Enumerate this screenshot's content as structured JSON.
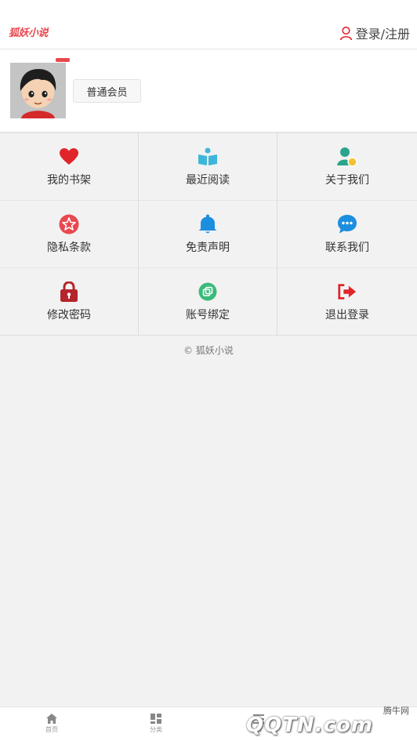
{
  "header": {
    "logo": "狐妖小说",
    "login_label": "登录/注册"
  },
  "profile": {
    "member_label": "普通会员"
  },
  "menu": [
    {
      "label": "我的书架",
      "icon": "heart-icon",
      "color": "#e0252a"
    },
    {
      "label": "最近阅读",
      "icon": "open-book-icon",
      "color": "#3fb6d8"
    },
    {
      "label": "关于我们",
      "icon": "user-coin-icon",
      "color": "#2aa58c"
    },
    {
      "label": "隐私条款",
      "icon": "star-badge-icon",
      "color": "#e8484f"
    },
    {
      "label": "免责声明",
      "icon": "bell-icon",
      "color": "#1c8ee0"
    },
    {
      "label": "联系我们",
      "icon": "chat-bubble-icon",
      "color": "#1c8ee0"
    },
    {
      "label": "修改密码",
      "icon": "lock-icon",
      "color": "#b3262b"
    },
    {
      "label": "账号绑定",
      "icon": "link-copy-icon",
      "color": "#3bba7a"
    },
    {
      "label": "退出登录",
      "icon": "logout-icon",
      "color": "#e0252a"
    }
  ],
  "footer": {
    "copyright": "© 狐妖小说"
  },
  "tabbar": [
    {
      "label": "首页",
      "icon": "home-icon"
    },
    {
      "label": "分类",
      "icon": "grid-icon"
    },
    {
      "label": "阅",
      "icon": "list-icon"
    }
  ],
  "watermark": {
    "site": "腾牛网",
    "logo": "QQTN.com"
  }
}
